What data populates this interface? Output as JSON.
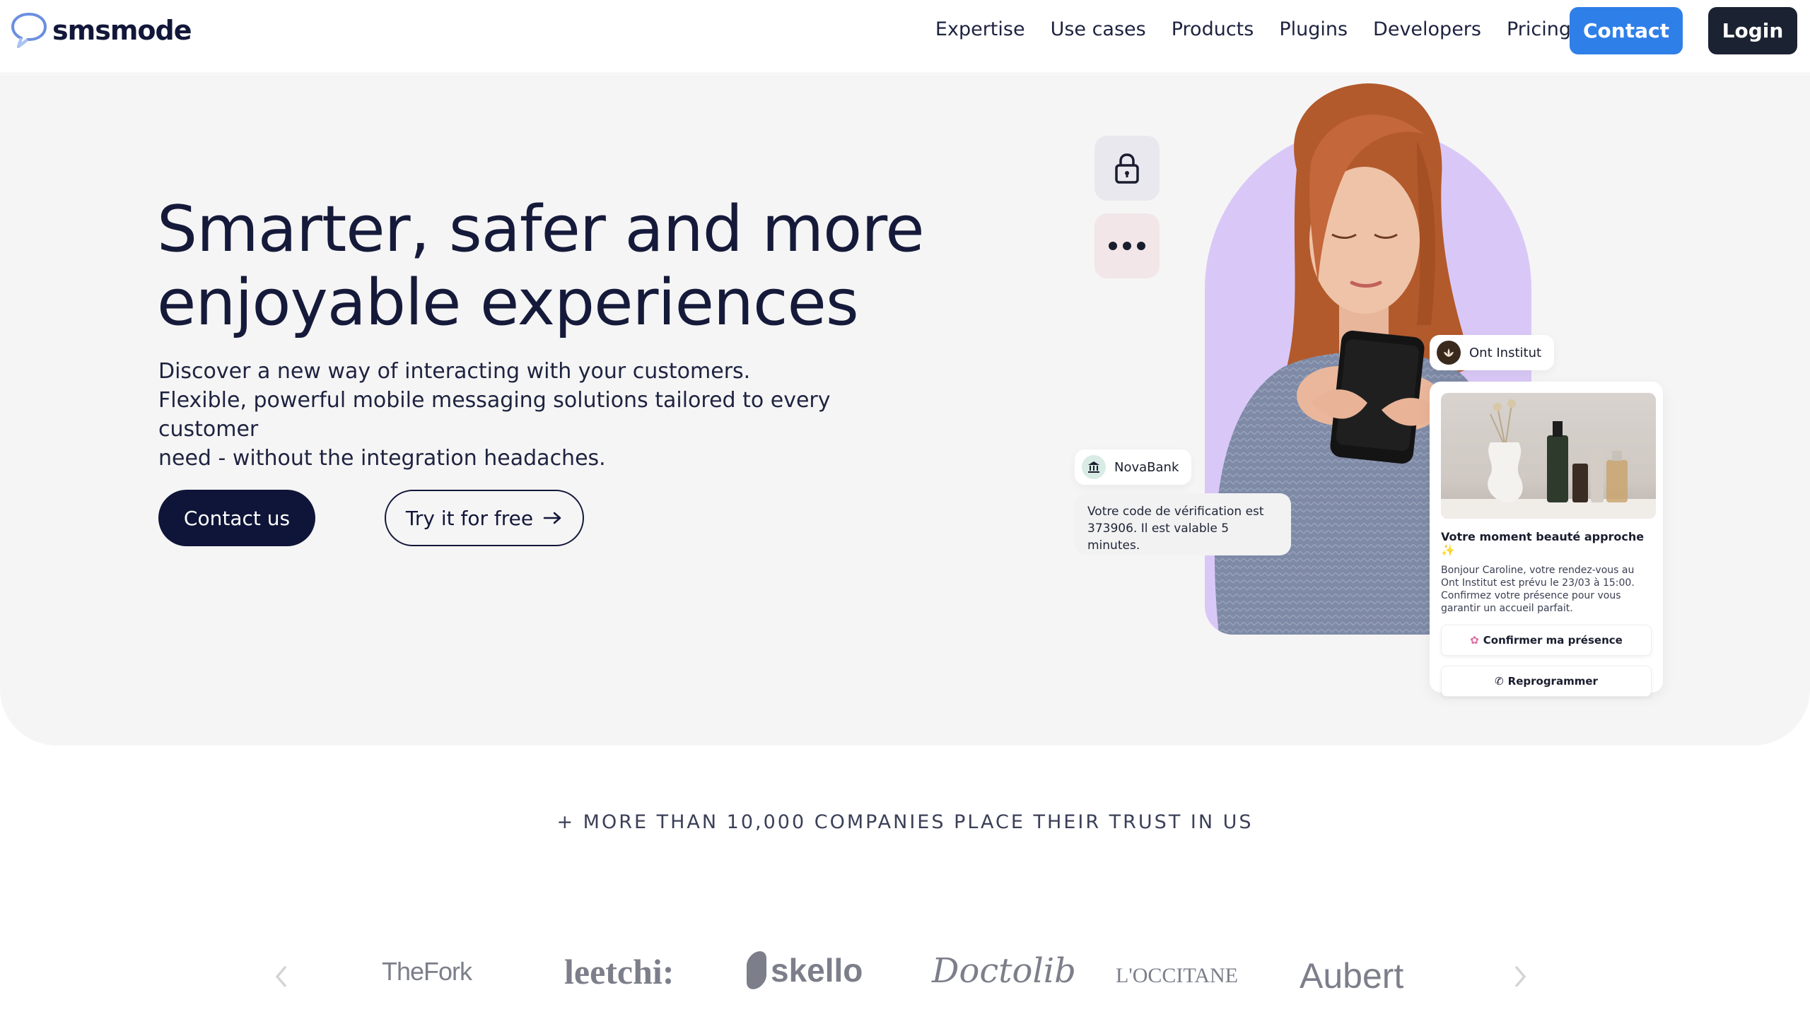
{
  "nav": {
    "logo_text": "smsmode",
    "links": [
      "Expertise",
      "Use cases",
      "Products",
      "Plugins",
      "Developers",
      "Pricing"
    ],
    "contact_label": "Contact",
    "login_label": "Login"
  },
  "hero": {
    "title_line1": "Smarter, safer and more",
    "title_line2": "enjoyable experiences",
    "subtitle_line1": "Discover a new way of interacting with your customers.",
    "subtitle_line2": "Flexible, powerful mobile messaging solutions tailored to every customer",
    "subtitle_line3": "need - without the integration headaches.",
    "primary_cta": "Contact us",
    "secondary_cta": "Try it for free"
  },
  "illustration": {
    "bank_name": "NovaBank",
    "bank_message": "Votre code de vérification est 373906. Il est valable 5 minutes.",
    "institute_name": "Ont Institut",
    "card_title": "Votre moment beauté approche ✨",
    "card_body": "Bonjour Caroline, votre rendez-vous au Ont Institut est prévu le 23/03 à 15:00. Confirmez votre présence pour vous garantir un accueil parfait.",
    "card_btn_confirm": "Confirmer ma présence",
    "card_btn_reschedule": "Reprogrammer"
  },
  "trust": {
    "headline": "+ MORE THAN 10,000 COMPANIES PLACE THEIR TRUST IN US",
    "brands": [
      "TheFork",
      "leetchi:",
      "skello",
      "Doctolib",
      "L'OCCITANE",
      "Aubert"
    ]
  },
  "colors": {
    "accent": "#2f7fe8",
    "dark": "#0f1538",
    "hero_bg": "#f5f5f5",
    "arch": "#d9c8f7"
  }
}
